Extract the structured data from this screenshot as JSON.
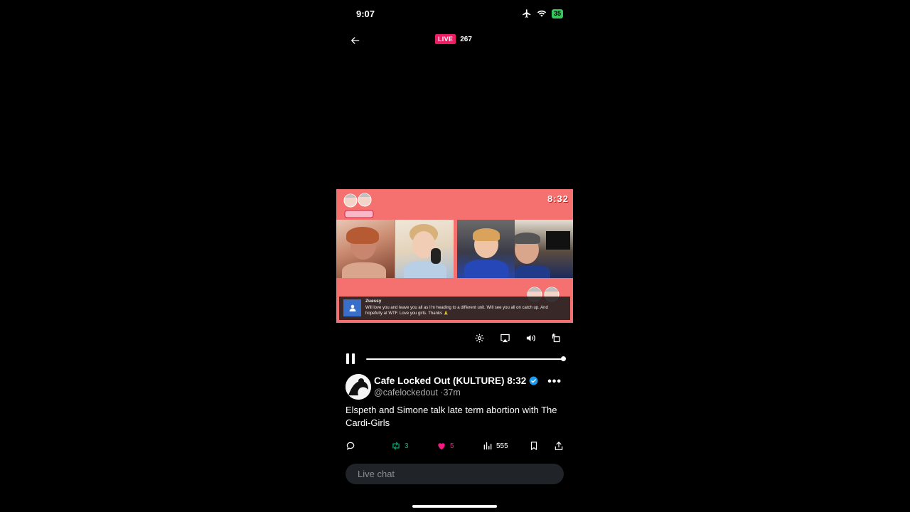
{
  "status_bar": {
    "time": "9:07",
    "battery": "35",
    "icons": [
      "airplane-icon",
      "wifi-icon",
      "battery-icon"
    ]
  },
  "header": {
    "live_label": "LIVE",
    "viewer_count": "267"
  },
  "video": {
    "timer": "8:32",
    "comment": {
      "name": "Zuessy",
      "text": "Will love you and leave you all as I'm heading to a different unit. Will see you all on catch up. And hopefully at WTF. Love you girls. Thanks 🙏"
    },
    "playback_progress": 1.0
  },
  "post": {
    "author": "Cafe Locked Out (KULTURE) 8:32",
    "handle": "@cafelockedout",
    "separator": "·",
    "time_ago": "37m",
    "text": "Elspeth and Simone talk late term abortion with The Cardi-Girls"
  },
  "actions": {
    "reposts": "3",
    "likes": "5",
    "views": "555"
  },
  "chat": {
    "placeholder": "Live chat"
  },
  "colors": {
    "live_badge": "#e91e63",
    "video_bg": "#f4716f",
    "repost_green": "#00ba7c",
    "like_pink": "#f91880",
    "verified_blue": "#1d9bf0"
  }
}
